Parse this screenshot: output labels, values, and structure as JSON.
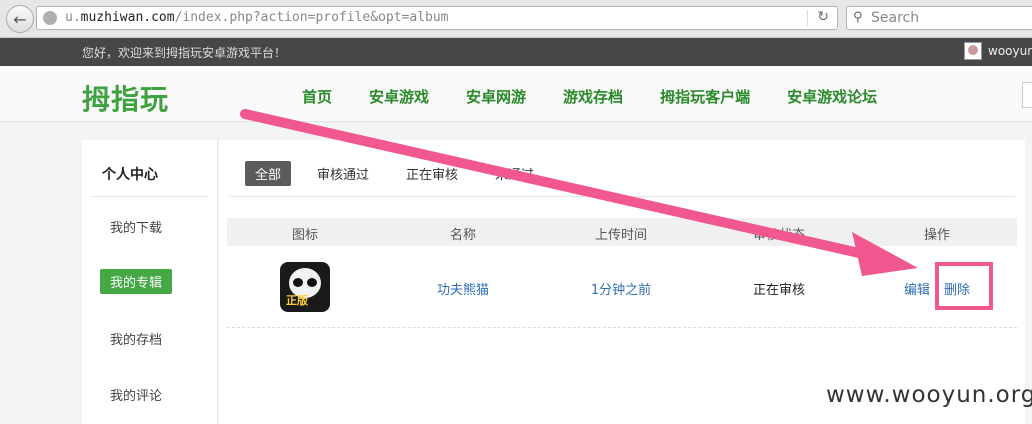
{
  "browser": {
    "url_prefix": "u.",
    "url_domain": "muzhiwan.com",
    "url_path": "/index.php?action=profile&opt=album",
    "search_placeholder": "Search"
  },
  "topbar": {
    "welcome": "您好，欢迎来到拇指玩安卓游戏平台！",
    "username": "wooyun"
  },
  "header": {
    "logo": "拇指玩",
    "nav": [
      "首页",
      "安卓游戏",
      "安卓网游",
      "游戏存档",
      "拇指玩客户端",
      "安卓游戏论坛"
    ]
  },
  "sidebar": {
    "title": "个人中心",
    "items": [
      "我的下载",
      "我的专辑",
      "我的存档",
      "我的评论"
    ],
    "active_index": 1
  },
  "tabs": [
    "全部",
    "审核通过",
    "正在审核",
    "未通过"
  ],
  "table": {
    "headers": [
      "图标",
      "名称",
      "上传时间",
      "审核状态",
      "操作"
    ],
    "rows": [
      {
        "icon_name": "kungfu-panda-icon",
        "icon_badge": "正版",
        "name": "功夫熊猫",
        "time": "1分钟之前",
        "status": "正在审核",
        "actions": [
          "编辑",
          "删除"
        ]
      }
    ]
  },
  "watermark": "www.wooyun.org",
  "colors": {
    "brand_green": "#3ea33e",
    "link_blue": "#2f6db5",
    "annotation_pink": "#f0588f"
  }
}
